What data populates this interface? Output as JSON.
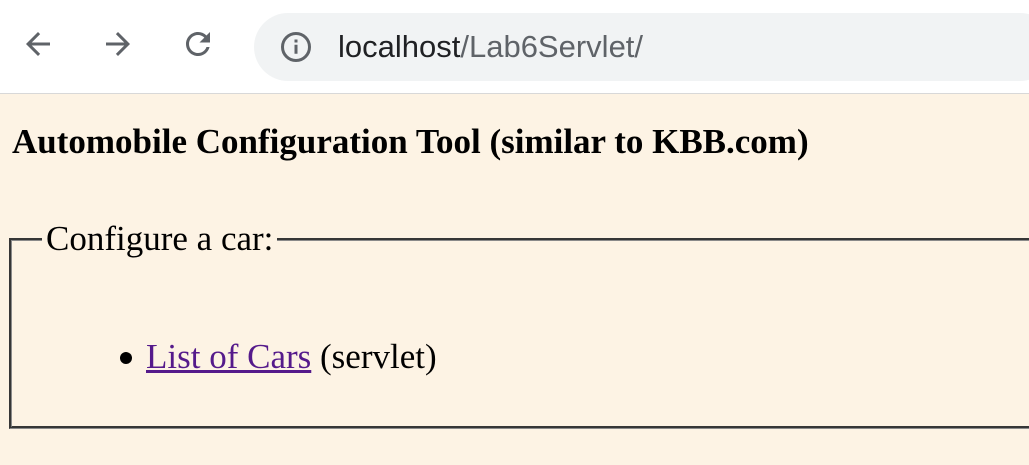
{
  "browser": {
    "back_icon": "arrow-left-icon",
    "forward_icon": "arrow-right-icon",
    "reload_icon": "reload-icon",
    "info_icon": "info-circle-icon",
    "url_host": "localhost",
    "url_path": "/Lab6Servlet/"
  },
  "page": {
    "title": "Automobile Configuration Tool (similar to KBB.com)",
    "fieldset_legend": "Configure a car:",
    "items": [
      {
        "link_text": "List of Cars",
        "suffix": " (servlet)"
      }
    ]
  },
  "colors": {
    "page_background": "#fdf3e4",
    "visited_link": "#551a8b",
    "omnibox": "#f1f3f4"
  }
}
